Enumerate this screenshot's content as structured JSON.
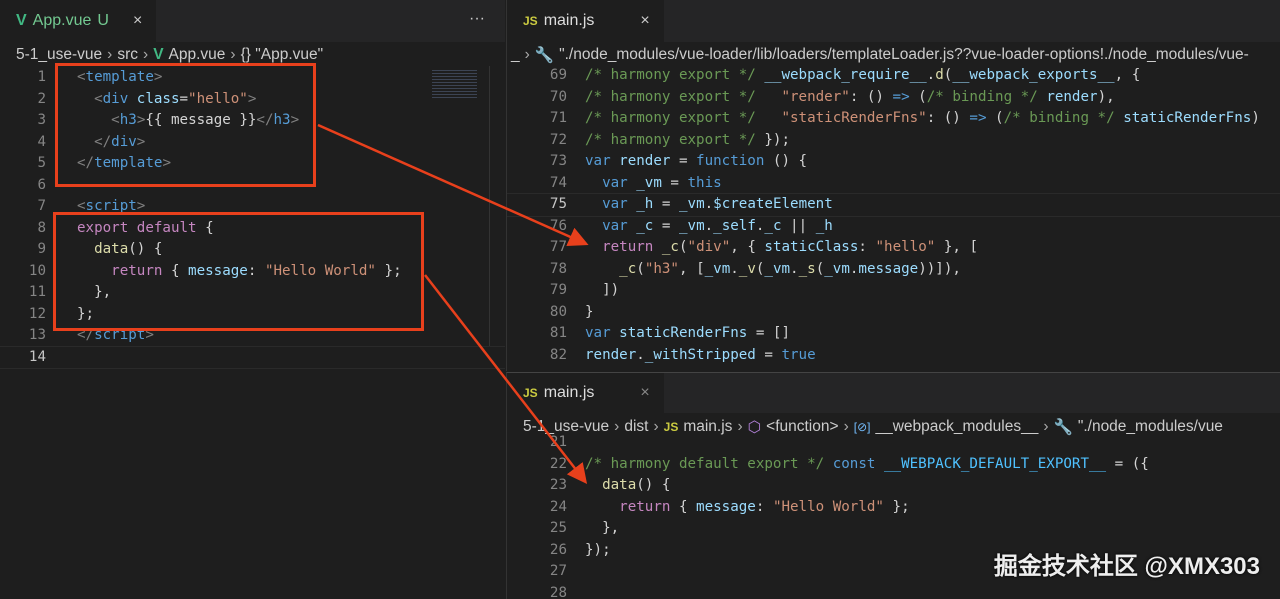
{
  "left": {
    "tab": {
      "icon": "vue-icon",
      "label": "App.vue",
      "status": "U",
      "close": "×"
    },
    "more": "···",
    "breadcrumb": [
      "5-1_use-vue",
      "src",
      "App.vue",
      "{} \"App.vue\""
    ],
    "start": 1,
    "current": 14,
    "lines": [
      [
        [
          "<",
          "tag"
        ],
        [
          "template",
          "tn"
        ],
        [
          ">",
          "tag"
        ]
      ],
      [
        [
          "  <",
          "tag"
        ],
        [
          "div",
          "tn"
        ],
        [
          " class",
          "at"
        ],
        [
          "=",
          "p"
        ],
        [
          "\"hello\"",
          "s"
        ],
        [
          ">",
          "tag"
        ]
      ],
      [
        [
          "    <",
          "tag"
        ],
        [
          "h3",
          "tn"
        ],
        [
          ">",
          "tag"
        ],
        [
          "{{ message }}",
          "p"
        ],
        [
          "</",
          "tag"
        ],
        [
          "h3",
          "tn"
        ],
        [
          ">",
          "tag"
        ]
      ],
      [
        [
          "  </",
          "tag"
        ],
        [
          "div",
          "tn"
        ],
        [
          ">",
          "tag"
        ]
      ],
      [
        [
          "</",
          "tag"
        ],
        [
          "template",
          "tn"
        ],
        [
          ">",
          "tag"
        ]
      ],
      [],
      [
        [
          "<",
          "tag"
        ],
        [
          "script",
          "tn"
        ],
        [
          ">",
          "tag"
        ]
      ],
      [
        [
          "export default",
          "ctl"
        ],
        [
          " {",
          "p"
        ]
      ],
      [
        [
          "  ",
          "p"
        ],
        [
          "data",
          "f"
        ],
        [
          "() {",
          "p"
        ]
      ],
      [
        [
          "    ",
          "p"
        ],
        [
          "return",
          "ctl"
        ],
        [
          " { ",
          "p"
        ],
        [
          "message",
          "v"
        ],
        [
          ": ",
          "p"
        ],
        [
          "\"Hello World\"",
          "s"
        ],
        [
          " };",
          "p"
        ]
      ],
      [
        [
          "  },",
          "p"
        ]
      ],
      [
        [
          "};",
          "p"
        ]
      ],
      [
        [
          "</",
          "tag"
        ],
        [
          "script",
          "tn"
        ],
        [
          ">",
          "tag"
        ]
      ],
      []
    ]
  },
  "top": {
    "tab": {
      "icon": "js-icon",
      "icon_text": "JS",
      "label": "main.js",
      "close": "×"
    },
    "breadcrumb": [
      "_",
      "\"./node_modules/vue-loader/lib/loaders/templateLoader.js??vue-loader-options!./node_modules/vue-"
    ],
    "start": 69,
    "current": 75,
    "lines": [
      [
        [
          "/* harmony export */ ",
          "c"
        ],
        [
          "__webpack_require__",
          "v"
        ],
        [
          ".",
          "p"
        ],
        [
          "d",
          "f"
        ],
        [
          "(",
          "p"
        ],
        [
          "__webpack_exports__",
          "v"
        ],
        [
          ", {",
          "p"
        ]
      ],
      [
        [
          "/* harmony export */   ",
          "c"
        ],
        [
          "\"render\"",
          "s"
        ],
        [
          ": () ",
          "p"
        ],
        [
          "=>",
          "k"
        ],
        [
          " (",
          "p"
        ],
        [
          "/* binding */ ",
          "c"
        ],
        [
          "render",
          "v"
        ],
        [
          "),",
          "p"
        ]
      ],
      [
        [
          "/* harmony export */   ",
          "c"
        ],
        [
          "\"staticRenderFns\"",
          "s"
        ],
        [
          ": () ",
          "p"
        ],
        [
          "=>",
          "k"
        ],
        [
          " (",
          "p"
        ],
        [
          "/* binding */ ",
          "c"
        ],
        [
          "staticRenderFns",
          "v"
        ],
        [
          ")",
          "p"
        ]
      ],
      [
        [
          "/* harmony export */ ",
          "c"
        ],
        [
          "});",
          "p"
        ]
      ],
      [
        [
          "var",
          "k"
        ],
        [
          " ",
          "p"
        ],
        [
          "render",
          "v"
        ],
        [
          " = ",
          "p"
        ],
        [
          "function",
          "k"
        ],
        [
          " () {",
          "p"
        ]
      ],
      [
        [
          "  ",
          "p"
        ],
        [
          "var",
          "k"
        ],
        [
          " ",
          "p"
        ],
        [
          "_vm",
          "v"
        ],
        [
          " = ",
          "p"
        ],
        [
          "this",
          "k"
        ]
      ],
      [
        [
          "  ",
          "p"
        ],
        [
          "var",
          "k"
        ],
        [
          " ",
          "p"
        ],
        [
          "_h",
          "v"
        ],
        [
          " = ",
          "p"
        ],
        [
          "_vm",
          "v"
        ],
        [
          ".",
          "p"
        ],
        [
          "$createElement",
          "v"
        ]
      ],
      [
        [
          "  ",
          "p"
        ],
        [
          "var",
          "k"
        ],
        [
          " ",
          "p"
        ],
        [
          "_c",
          "v"
        ],
        [
          " = ",
          "p"
        ],
        [
          "_vm",
          "v"
        ],
        [
          ".",
          "p"
        ],
        [
          "_self",
          "v"
        ],
        [
          ".",
          "p"
        ],
        [
          "_c",
          "v"
        ],
        [
          " || ",
          "p"
        ],
        [
          "_h",
          "v"
        ]
      ],
      [
        [
          "  ",
          "p"
        ],
        [
          "return",
          "ctl"
        ],
        [
          " ",
          "p"
        ],
        [
          "_c",
          "f"
        ],
        [
          "(",
          "p"
        ],
        [
          "\"div\"",
          "s"
        ],
        [
          ", { ",
          "p"
        ],
        [
          "staticClass",
          "v"
        ],
        [
          ": ",
          "p"
        ],
        [
          "\"hello\"",
          "s"
        ],
        [
          " }, [",
          "p"
        ]
      ],
      [
        [
          "    ",
          "p"
        ],
        [
          "_c",
          "f"
        ],
        [
          "(",
          "p"
        ],
        [
          "\"h3\"",
          "s"
        ],
        [
          ", [",
          "p"
        ],
        [
          "_vm",
          "v"
        ],
        [
          ".",
          "p"
        ],
        [
          "_v",
          "f"
        ],
        [
          "(",
          "p"
        ],
        [
          "_vm",
          "v"
        ],
        [
          ".",
          "p"
        ],
        [
          "_s",
          "f"
        ],
        [
          "(",
          "p"
        ],
        [
          "_vm",
          "v"
        ],
        [
          ".",
          "p"
        ],
        [
          "message",
          "v"
        ],
        [
          ")",
          "p"
        ],
        [
          ")",
          "p"
        ],
        [
          "]),",
          "p"
        ]
      ],
      [
        [
          "  ])",
          "p"
        ]
      ],
      [
        [
          "}",
          "p"
        ]
      ],
      [
        [
          "var",
          "k"
        ],
        [
          " ",
          "p"
        ],
        [
          "staticRenderFns",
          "v"
        ],
        [
          " = []",
          "p"
        ]
      ],
      [
        [
          "render",
          "v"
        ],
        [
          ".",
          "p"
        ],
        [
          "_withStripped",
          "v"
        ],
        [
          " = ",
          "p"
        ],
        [
          "true",
          "k"
        ]
      ]
    ]
  },
  "bottom": {
    "tab": {
      "icon": "js-icon",
      "icon_text": "JS",
      "label": "main.js",
      "close": "×"
    },
    "breadcrumb": [
      "5-1_use-vue",
      "dist",
      "main.js",
      "<function>",
      "__webpack_modules__",
      "\"./node_modules/vue"
    ],
    "start": 21,
    "current": 0,
    "lines": [
      [],
      [
        [
          "/* harmony default export */ ",
          "c"
        ],
        [
          "const",
          "k"
        ],
        [
          " ",
          "p"
        ],
        [
          "__WEBPACK_DEFAULT_EXPORT__",
          "cn"
        ],
        [
          " = ({",
          "p"
        ]
      ],
      [
        [
          "  ",
          "p"
        ],
        [
          "data",
          "f"
        ],
        [
          "() {",
          "p"
        ]
      ],
      [
        [
          "    ",
          "p"
        ],
        [
          "return",
          "ctl"
        ],
        [
          " { ",
          "p"
        ],
        [
          "message",
          "v"
        ],
        [
          ": ",
          "p"
        ],
        [
          "\"Hello World\"",
          "s"
        ],
        [
          " };",
          "p"
        ]
      ],
      [
        [
          "  },",
          "p"
        ]
      ],
      [
        [
          "});",
          "p"
        ]
      ],
      [],
      []
    ]
  },
  "watermark": "掘金技术社区 @XMX303",
  "annotation_color": "#e8401c"
}
